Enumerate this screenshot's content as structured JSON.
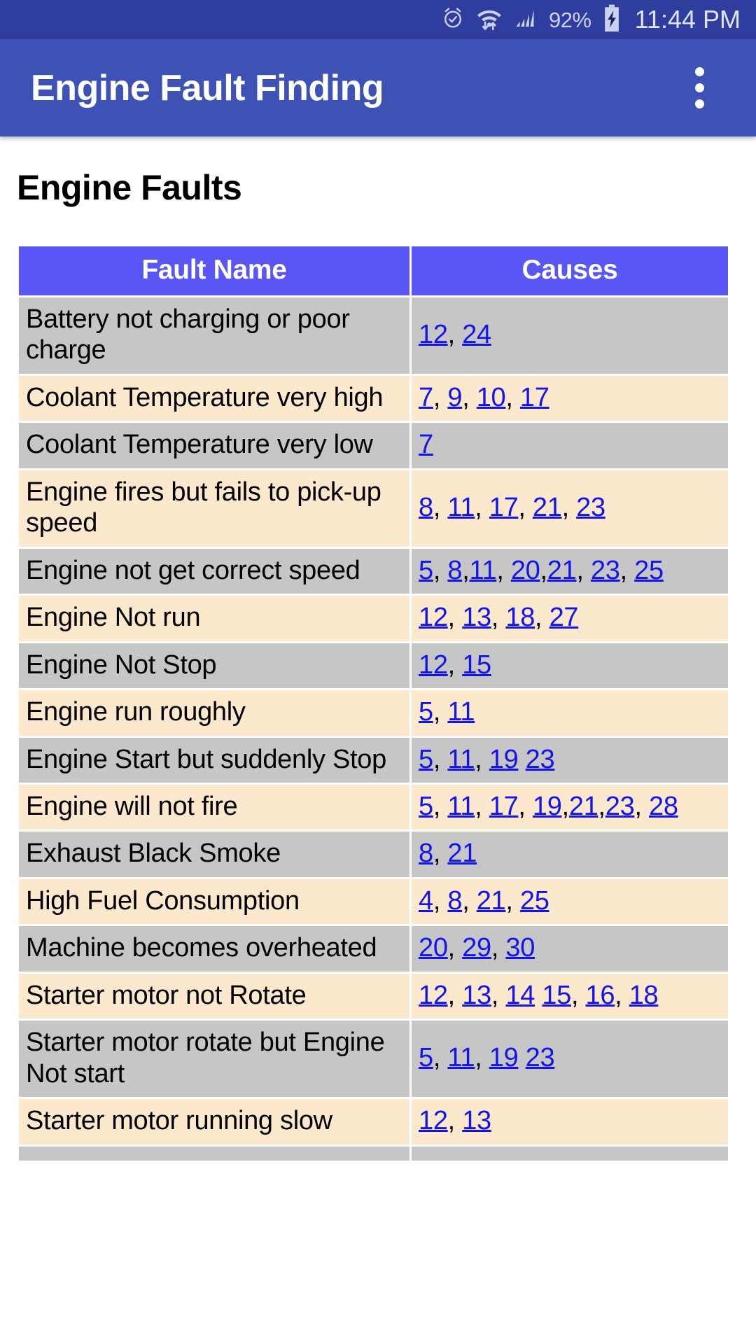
{
  "statusbar": {
    "icons": [
      "alarm-icon",
      "wifi-icon",
      "signal-icon",
      "battery-charging-icon"
    ],
    "battery_percent": "92%",
    "clock": "11:44 PM"
  },
  "appbar": {
    "title": "Engine Fault Finding",
    "overflow_label": "More options"
  },
  "page": {
    "heading": "Engine Faults"
  },
  "table": {
    "headers": [
      "Fault Name",
      "Causes"
    ],
    "rows": [
      {
        "name": "Battery not charging or poor charge",
        "causes": [
          "12",
          "24"
        ],
        "separators": [
          ", "
        ]
      },
      {
        "name": "Coolant Temperature very high",
        "causes": [
          "7",
          "9",
          "10",
          "17"
        ],
        "separators": [
          ", ",
          ", ",
          ", "
        ]
      },
      {
        "name": "Coolant Temperature very low",
        "causes": [
          "7"
        ],
        "separators": []
      },
      {
        "name": "Engine fires but fails to pick-up speed",
        "causes": [
          "8",
          "11",
          "17",
          "21",
          "23"
        ],
        "separators": [
          ", ",
          ", ",
          ", ",
          ", "
        ]
      },
      {
        "name": "Engine not get correct speed",
        "causes": [
          "5",
          "8",
          "11",
          "20",
          "21",
          "23",
          "25"
        ],
        "separators": [
          ", ",
          ",",
          ", ",
          ",",
          ", ",
          ", "
        ]
      },
      {
        "name": "Engine Not run",
        "causes": [
          "12",
          "13",
          "18",
          "27"
        ],
        "separators": [
          ", ",
          ", ",
          ", "
        ]
      },
      {
        "name": "Engine Not Stop",
        "causes": [
          "12",
          "15"
        ],
        "separators": [
          ", "
        ]
      },
      {
        "name": "Engine run roughly",
        "causes": [
          "5",
          "11"
        ],
        "separators": [
          ", "
        ]
      },
      {
        "name": "Engine Start but suddenly Stop",
        "causes": [
          "5",
          "11",
          "19",
          "23"
        ],
        "separators": [
          ", ",
          ", ",
          " "
        ]
      },
      {
        "name": "Engine will not fire",
        "causes": [
          "5",
          "11",
          "17",
          "19",
          "21",
          "23",
          "28"
        ],
        "separators": [
          ", ",
          ", ",
          ", ",
          ",",
          ",",
          ", "
        ]
      },
      {
        "name": "Exhaust Black Smoke",
        "causes": [
          "8",
          "21"
        ],
        "separators": [
          ", "
        ]
      },
      {
        "name": "High Fuel Consumption",
        "causes": [
          "4",
          "8",
          "21",
          "25"
        ],
        "separators": [
          ", ",
          ", ",
          ", "
        ]
      },
      {
        "name": "Machine becomes overheated",
        "causes": [
          "20",
          "29",
          "30"
        ],
        "separators": [
          ", ",
          ", "
        ]
      },
      {
        "name": "Starter motor not Rotate",
        "causes": [
          "12",
          "13",
          "14",
          "15",
          "16",
          "18"
        ],
        "separators": [
          ", ",
          ", ",
          " ",
          ", ",
          ", "
        ]
      },
      {
        "name": "Starter motor rotate but Engine Not start",
        "causes": [
          "5",
          "11",
          "19",
          "23"
        ],
        "separators": [
          ", ",
          ", ",
          " "
        ]
      },
      {
        "name": "Starter motor running slow",
        "causes": [
          "12",
          "13"
        ],
        "separators": [
          ", "
        ]
      },
      {
        "name": "",
        "causes": [],
        "separators": []
      }
    ]
  },
  "colors": {
    "statusbar": "#2f3e9e",
    "appbar": "#3e51b4",
    "table_header": "#5a56f6",
    "row_odd": "#c6c6c6",
    "row_even": "#fce8cc",
    "link": "#1114ee"
  }
}
